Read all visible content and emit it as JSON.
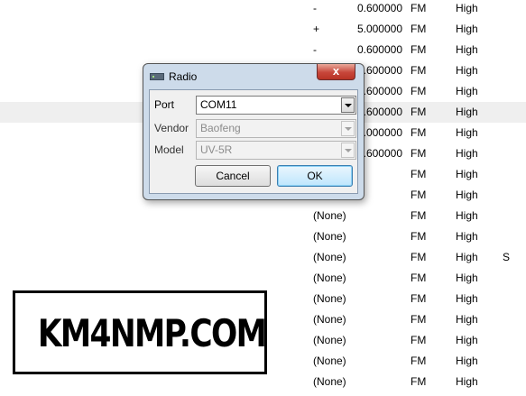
{
  "channel_rows": [
    {
      "tone": "",
      "offset": "-",
      "freq": "0.600000",
      "mode": "FM",
      "power": "High",
      "skip": ""
    },
    {
      "tone": "",
      "offset": "+",
      "freq": "5.000000",
      "mode": "FM",
      "power": "High",
      "skip": ""
    },
    {
      "tone": "",
      "offset": "-",
      "freq": "0.600000",
      "mode": "FM",
      "power": "High",
      "skip": ""
    },
    {
      "tone": "",
      "offset": "",
      "freq": "0.600000",
      "mode": "FM",
      "power": "High",
      "skip": ""
    },
    {
      "tone": "",
      "offset": "",
      "freq": "0.600000",
      "mode": "FM",
      "power": "High",
      "skip": ""
    },
    {
      "tone": "",
      "offset": "",
      "freq": "0.600000",
      "mode": "FM",
      "power": "High",
      "skip": ""
    },
    {
      "tone": "",
      "offset": "",
      "freq": "5.000000",
      "mode": "FM",
      "power": "High",
      "skip": ""
    },
    {
      "tone": "",
      "offset": "",
      "freq": "0.600000",
      "mode": "FM",
      "power": "High",
      "skip": ""
    },
    {
      "tone": "",
      "offset": "",
      "freq": "",
      "mode": "FM",
      "power": "High",
      "skip": ""
    },
    {
      "tone": "",
      "offset": "",
      "freq": "",
      "mode": "FM",
      "power": "High",
      "skip": ""
    },
    {
      "tone": "(None)",
      "offset": "",
      "freq": "",
      "mode": "FM",
      "power": "High",
      "skip": ""
    },
    {
      "tone": "(None)",
      "offset": "",
      "freq": "",
      "mode": "FM",
      "power": "High",
      "skip": ""
    },
    {
      "tone": "(None)",
      "offset": "",
      "freq": "",
      "mode": "FM",
      "power": "High",
      "skip": "S"
    },
    {
      "tone": "(None)",
      "offset": "",
      "freq": "",
      "mode": "FM",
      "power": "High",
      "skip": ""
    },
    {
      "tone": "(None)",
      "offset": "",
      "freq": "",
      "mode": "FM",
      "power": "High",
      "skip": ""
    },
    {
      "tone": "(None)",
      "offset": "",
      "freq": "",
      "mode": "FM",
      "power": "High",
      "skip": ""
    },
    {
      "tone": "(None)",
      "offset": "",
      "freq": "",
      "mode": "FM",
      "power": "High",
      "skip": ""
    },
    {
      "tone": "(None)",
      "offset": "",
      "freq": "",
      "mode": "FM",
      "power": "High",
      "skip": ""
    },
    {
      "tone": "(None)",
      "offset": "",
      "freq": "",
      "mode": "FM",
      "power": "High",
      "skip": ""
    }
  ],
  "highlight_row": 5,
  "logo": {
    "text": "KM4NMP.COM"
  },
  "dialog": {
    "title": "Radio",
    "title_icon": "radio-icon",
    "close_label": "x",
    "port": {
      "label": "Port",
      "value": "COM11"
    },
    "vendor": {
      "label": "Vendor",
      "value": "Baofeng"
    },
    "model": {
      "label": "Model",
      "value": "UV-5R"
    },
    "cancel_label": "Cancel",
    "ok_label": "OK"
  }
}
